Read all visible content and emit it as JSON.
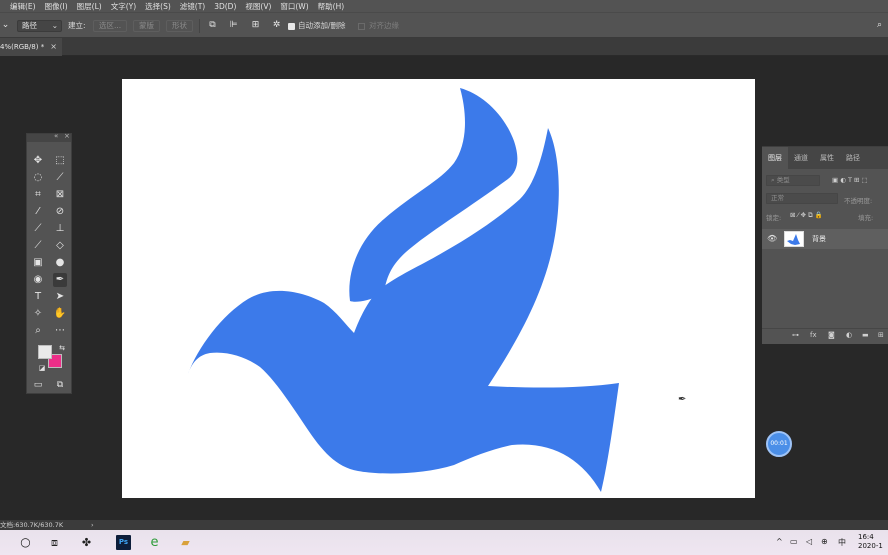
{
  "menu": [
    "编辑(E)",
    "图像(I)",
    "图层(L)",
    "文字(Y)",
    "选择(S)",
    "滤镜(T)",
    "3D(D)",
    "视图(V)",
    "窗口(W)",
    "帮助(H)"
  ],
  "options": {
    "mode_select": "路径",
    "build_label": "建立:",
    "selection_btn": "选区...",
    "mask_btn": "蒙版",
    "shape_btn": "形状",
    "auto_add_delete": "自动添加/删除",
    "align_edges": "对齐边缘"
  },
  "document_tab": {
    "title": "4%(RGB/8) *",
    "close": "×"
  },
  "tools_panel": {
    "collapse": "«",
    "close": "×"
  },
  "layers_panel": {
    "tabs": [
      "图层",
      "通道",
      "属性",
      "路径"
    ],
    "kind_placeholder": "类型",
    "blend_mode": "正常",
    "opacity_label": "不透明度:",
    "lock_label": "锁定:",
    "fill_label": "填充:",
    "layer_name": "背景"
  },
  "timer": "00:01",
  "status": {
    "doc_info": "文档:630.7K/630.7K",
    "arrow": "›"
  },
  "taskbar": {
    "ps_label": "Ps",
    "clock_time": "16:4",
    "clock_date": "2020-1"
  },
  "colors": {
    "bird": "#3c7aea",
    "background_swatch": "#ec2e88",
    "foreground_swatch": "#eaeaea"
  },
  "icons": [
    "search-icon",
    "task-view-icon",
    "pinwheel-icon",
    "photoshop-icon",
    "ie-icon",
    "folder-icon"
  ]
}
